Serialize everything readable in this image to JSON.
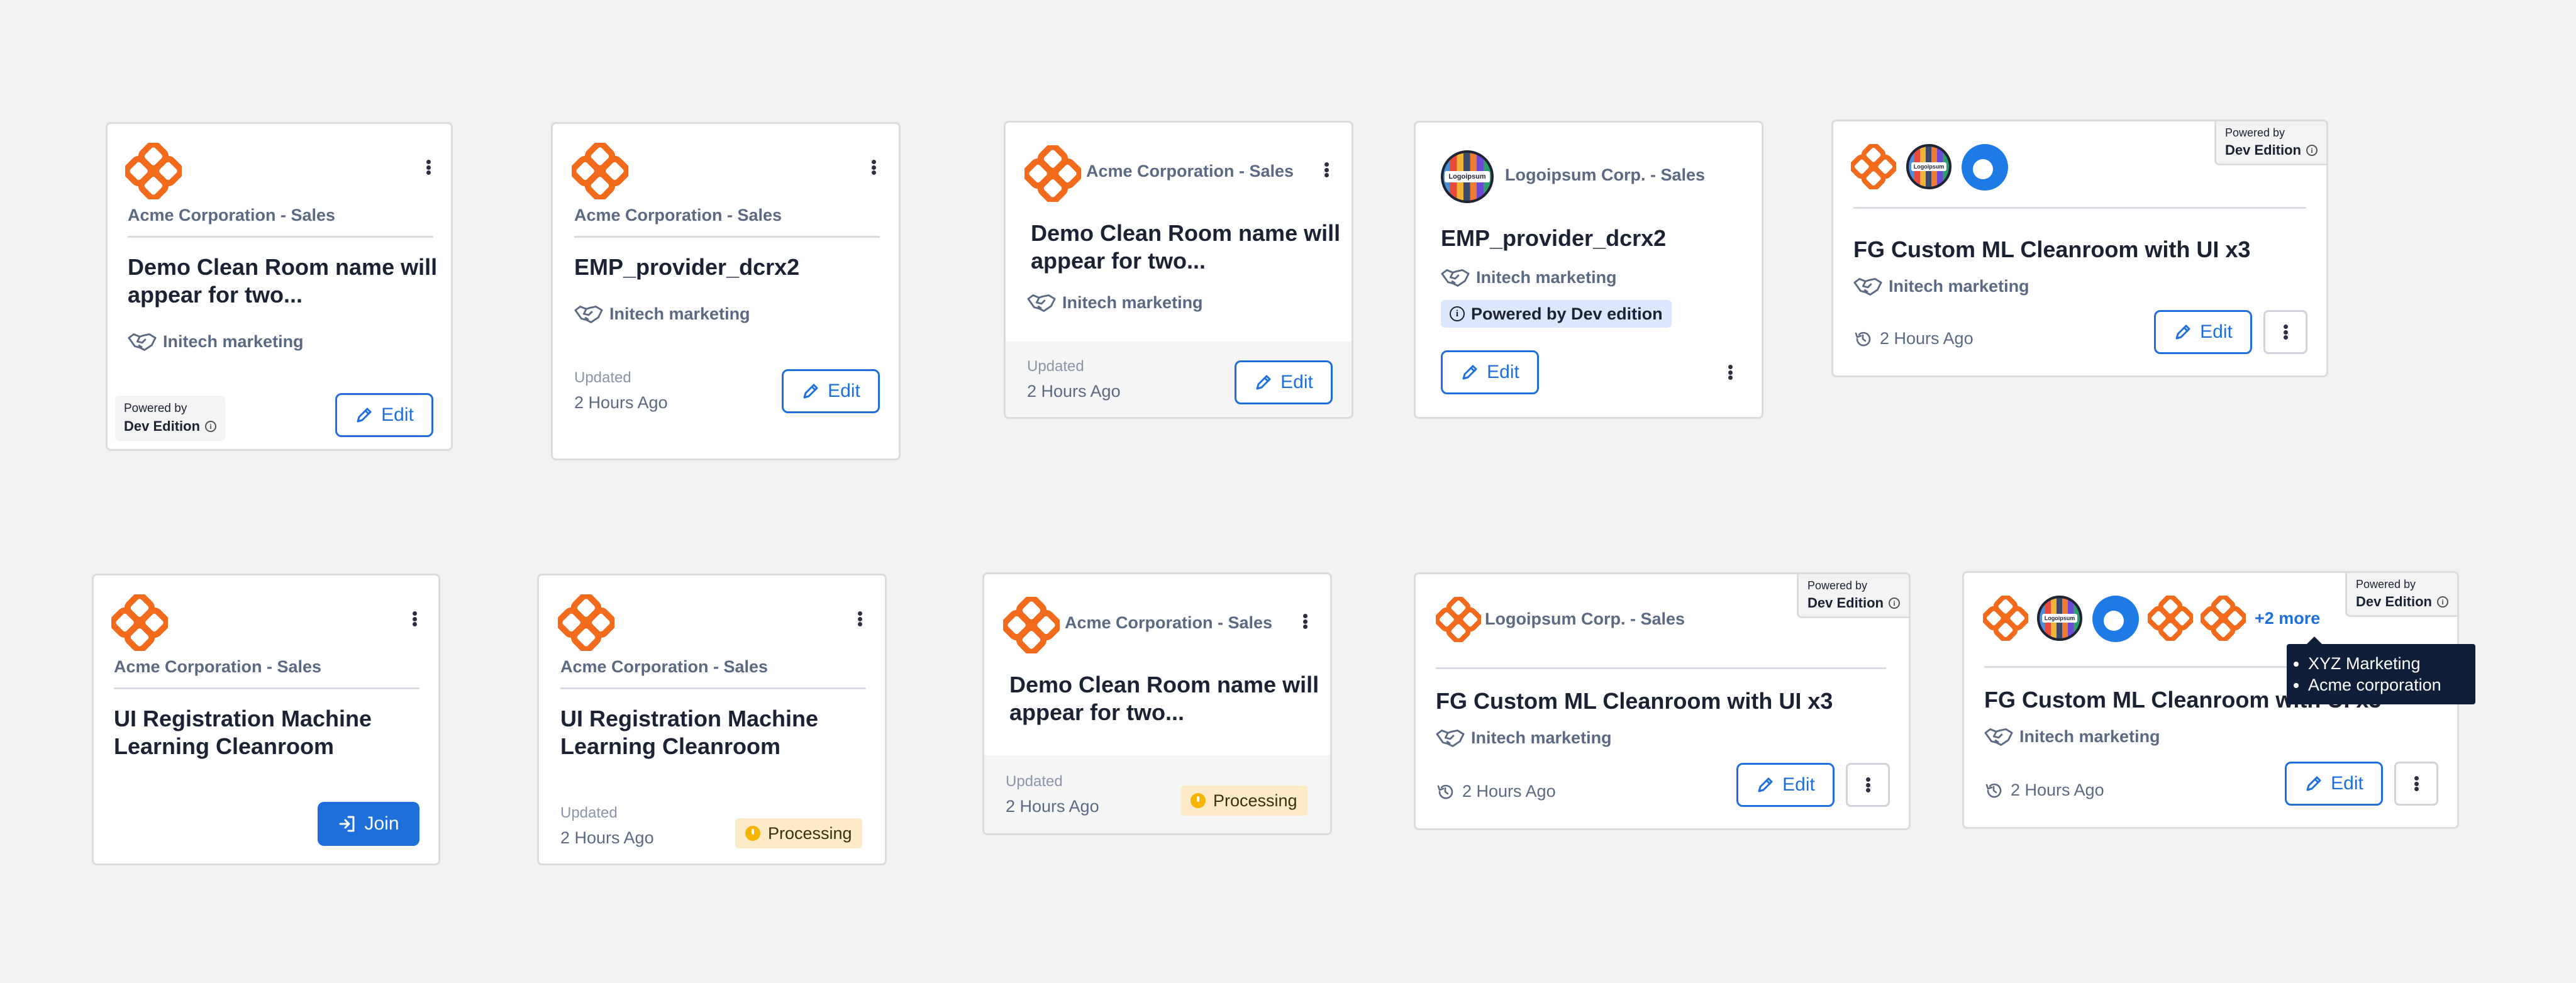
{
  "common": {
    "edit_label": "Edit",
    "join_label": "Join",
    "updated_label": "Updated",
    "updated_value": "2 Hours Ago",
    "processing_label": "Processing",
    "powered_by": "Powered by",
    "dev_edition": "Dev Edition",
    "powered_by_dev_edition": "Powered by Dev edition",
    "party": "Initech marketing"
  },
  "cards": [
    {
      "subtitle": "Acme Corporation - Sales",
      "title": "Demo Clean Room name will appear for two..."
    },
    {
      "subtitle": "Acme Corporation - Sales",
      "title": "EMP_provider_dcrx2"
    },
    {
      "subtitle": "Acme Corporation - Sales",
      "title": "Demo Clean Room name will appear for two..."
    },
    {
      "subtitle": "Logoipsum Corp. - Sales",
      "title": "EMP_provider_dcrx2"
    },
    {
      "title": "FG Custom ML Cleanroom with UI x3"
    },
    {
      "subtitle": "Acme Corporation - Sales",
      "title": "UI Registration Machine Learning Cleanroom"
    },
    {
      "subtitle": "Acme Corporation - Sales",
      "title": "UI Registration Machine Learning Cleanroom"
    },
    {
      "subtitle": "Acme Corporation - Sales",
      "title": "Demo Clean Room name will appear for two..."
    },
    {
      "subtitle": "Logoipsum Corp. - Sales",
      "title": "FG Custom ML Cleanroom with UI x3"
    },
    {
      "title": "FG Custom ML Cleanroom with UI x3",
      "more_label": "+2 more"
    }
  ],
  "logoipsum_text": "Logoipsum",
  "tooltip": {
    "items": [
      "XYZ Marketing",
      "Acme corporation"
    ]
  },
  "colors": {
    "accent": "#1e6fd9",
    "brand_orange": "#f26a1b",
    "background": "#f2f2f2"
  }
}
